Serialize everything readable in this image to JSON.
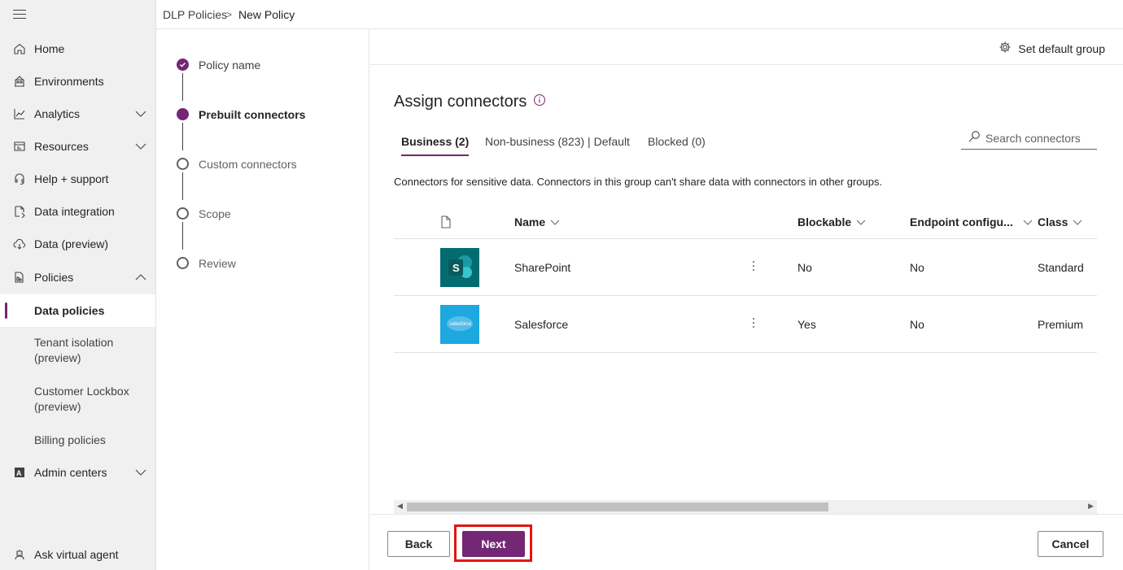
{
  "nav": {
    "items": [
      {
        "label": "Home",
        "icon": "home-icon"
      },
      {
        "label": "Environments",
        "icon": "environments-icon"
      },
      {
        "label": "Analytics",
        "icon": "analytics-icon"
      },
      {
        "label": "Resources",
        "icon": "resources-icon"
      },
      {
        "label": "Help + support",
        "icon": "headset-icon"
      },
      {
        "label": "Data integration",
        "icon": "data-integration-icon"
      },
      {
        "label": "Data (preview)",
        "icon": "cloud-data-icon"
      },
      {
        "label": "Policies",
        "icon": "policies-icon"
      },
      {
        "label": "Admin centers",
        "icon": "admin-centers-icon"
      },
      {
        "label": "Ask virtual agent",
        "icon": "virtual-agent-icon"
      }
    ],
    "policies_sub": [
      {
        "label": "Data policies",
        "active": true
      },
      {
        "label": "Tenant isolation (preview)",
        "active": false
      },
      {
        "label": "Customer Lockbox (preview)",
        "active": false
      },
      {
        "label": "Billing policies",
        "active": false
      }
    ]
  },
  "breadcrumb": {
    "parent": "DLP Policies",
    "separator": ">",
    "current": "New Policy"
  },
  "steps": [
    {
      "label": "Policy name",
      "state": "done"
    },
    {
      "label": "Prebuilt connectors",
      "state": "current"
    },
    {
      "label": "Custom connectors",
      "state": "todo"
    },
    {
      "label": "Scope",
      "state": "todo"
    },
    {
      "label": "Review",
      "state": "todo"
    }
  ],
  "command_bar": {
    "set_default_group": "Set default group"
  },
  "page": {
    "title": "Assign connectors",
    "description": "Connectors for sensitive data. Connectors in this group can't share data with connectors in other groups."
  },
  "tabs": [
    {
      "label": "Business (2)",
      "active": true
    },
    {
      "label": "Non-business (823) | Default",
      "active": false
    },
    {
      "label": "Blocked (0)",
      "active": false
    }
  ],
  "search": {
    "placeholder": "Search connectors"
  },
  "grid": {
    "columns": [
      "Name",
      "Blockable",
      "Endpoint configu...",
      "Class"
    ],
    "rows": [
      {
        "name": "SharePoint",
        "blockable": "No",
        "endpoint": "No",
        "class": "Standard",
        "logo_text": "S",
        "logo_color": "#036c70"
      },
      {
        "name": "Salesforce",
        "blockable": "Yes",
        "endpoint": "No",
        "class": "Premium",
        "logo_text": "salesforce",
        "logo_color": "#1ea8e0"
      }
    ]
  },
  "footer": {
    "back": "Back",
    "next": "Next",
    "cancel": "Cancel"
  },
  "colors": {
    "accent": "#742774",
    "highlight": "#e01515"
  }
}
